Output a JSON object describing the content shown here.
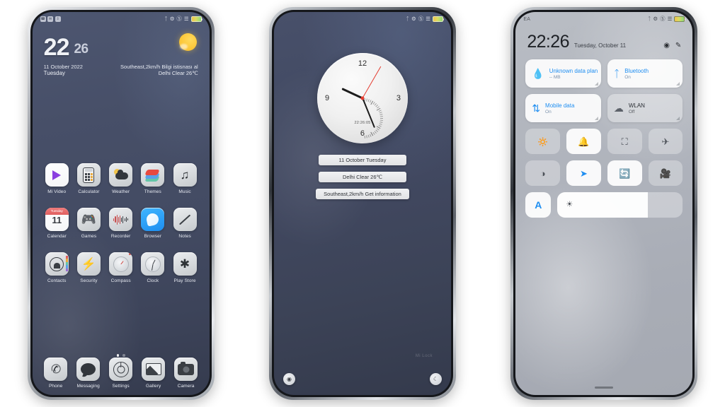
{
  "phone1": {
    "name": "home-screen",
    "statusbar": {
      "left_icons": [
        "call-icon",
        "mail-icon",
        "download-icon"
      ],
      "right_icons": [
        "bluetooth-icon",
        "sync-icon",
        "dnd-icon",
        "signal-icon",
        "battery-icon"
      ]
    },
    "widget": {
      "hour": "22",
      "minute": "26",
      "date": "11 October 2022",
      "day": "Tuesday",
      "wind": "Southeast,2km/h Bilgi istisnası al",
      "weather": "Delhi Clear  26℃",
      "weather_icon": "sun-icon"
    },
    "apps": [
      {
        "label": "Mi Video",
        "icon": "mi-video-icon"
      },
      {
        "label": "Calculator",
        "icon": "calculator-icon"
      },
      {
        "label": "Weather",
        "icon": "weather-icon"
      },
      {
        "label": "Themes",
        "icon": "themes-icon"
      },
      {
        "label": "Music",
        "icon": "music-icon"
      },
      {
        "label": "Calendar",
        "icon": "calendar-icon"
      },
      {
        "label": "Games",
        "icon": "games-icon"
      },
      {
        "label": "Recorder",
        "icon": "recorder-icon"
      },
      {
        "label": "Browser",
        "icon": "browser-icon"
      },
      {
        "label": "Notes",
        "icon": "notes-icon"
      },
      {
        "label": "Contacts",
        "icon": "contacts-icon"
      },
      {
        "label": "Security",
        "icon": "security-icon"
      },
      {
        "label": "Compass",
        "icon": "compass-icon"
      },
      {
        "label": "Clock",
        "icon": "clock-icon"
      },
      {
        "label": "Play Store",
        "icon": "play-store-icon"
      }
    ],
    "calendar_icon": {
      "weekday": "Tuesday",
      "day": "11"
    },
    "dock": [
      {
        "label": "Phone",
        "icon": "phone-icon"
      },
      {
        "label": "Messaging",
        "icon": "message-icon"
      },
      {
        "label": "Settings",
        "icon": "gear-icon"
      },
      {
        "label": "Gallery",
        "icon": "gallery-icon"
      },
      {
        "label": "Camera",
        "icon": "camera-icon"
      }
    ],
    "pages": {
      "count": 2,
      "active": 1
    }
  },
  "phone2": {
    "name": "clock-widget-screen",
    "statusbar": {
      "right_icons": [
        "bluetooth-icon",
        "sync-icon",
        "dnd-icon",
        "signal-icon",
        "battery-icon"
      ]
    },
    "clock": {
      "numerals": [
        "12",
        "3",
        "6",
        "9"
      ],
      "digital": "22:26:05",
      "hour_angle": -65,
      "minute_angle": 158,
      "second_angle": 30
    },
    "chips": [
      "11 October Tuesday",
      "Delhi  Clear  26℃",
      "Southeast,2km/h Get information"
    ],
    "corner_buttons": [
      {
        "icon": "camera-icon",
        "position": "left"
      },
      {
        "icon": "flashlight-icon",
        "position": "right"
      }
    ],
    "watermark": "Mi Lock"
  },
  "phone3": {
    "name": "quick-settings-panel",
    "statusbar": {
      "carrier": "EA",
      "right_icons": [
        "bluetooth-icon",
        "sync-icon",
        "dnd-icon",
        "signal-icon",
        "battery-icon"
      ]
    },
    "header": {
      "time": "22:26",
      "date": "Tuesday, October 11",
      "icons": [
        "settings-gear-icon",
        "edit-icon"
      ]
    },
    "big_tiles": [
      {
        "title": "Unknown data plan",
        "sub": "-- MB",
        "icon": "data-drop-icon",
        "state": "on"
      },
      {
        "title": "Bluetooth",
        "sub": "On",
        "icon": "bluetooth-icon",
        "state": "on"
      },
      {
        "title": "Mobile data",
        "sub": "On",
        "icon": "mobile-data-icon",
        "state": "on"
      },
      {
        "title": "WLAN",
        "sub": "Off",
        "icon": "wifi-icon",
        "state": "off"
      }
    ],
    "small_tiles": [
      {
        "icon": "flashlight-icon",
        "glyph": "⸺",
        "state": "off"
      },
      {
        "icon": "silent-bell-icon",
        "glyph": "ὑ5",
        "state": "on"
      },
      {
        "icon": "screenshot-icon",
        "glyph": "⛶",
        "state": "off"
      },
      {
        "icon": "airplane-icon",
        "glyph": "✈",
        "state": "off"
      },
      {
        "icon": "dark-mode-icon",
        "glyph": "◑",
        "state": "off"
      },
      {
        "icon": "location-icon",
        "glyph": "➤",
        "state": "on"
      },
      {
        "icon": "auto-rotate-icon",
        "glyph": "↻",
        "state": "on"
      },
      {
        "icon": "screen-record-icon",
        "glyph": "▶",
        "state": "off"
      }
    ],
    "bottom": {
      "font_button": "A",
      "brightness_icon": "brightness-icon",
      "brightness_percent": 72
    }
  }
}
